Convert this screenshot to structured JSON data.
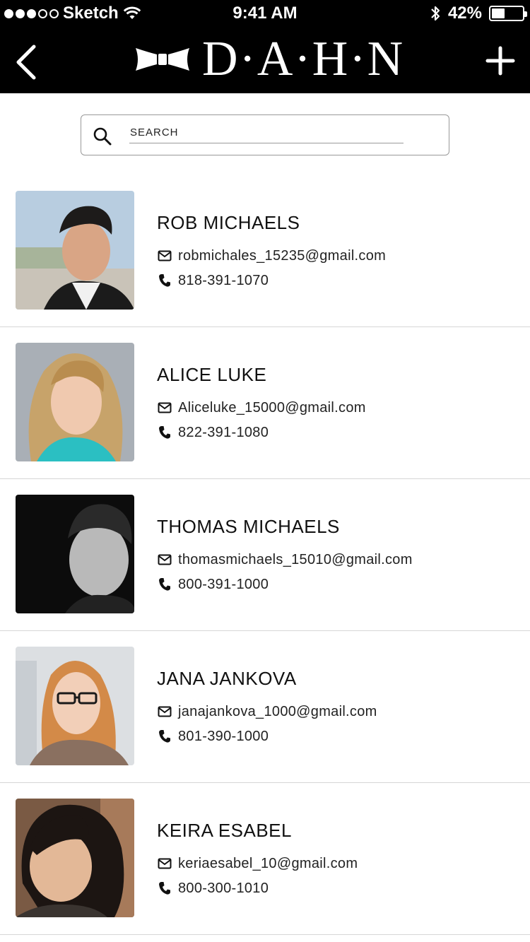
{
  "status_bar": {
    "carrier": "Sketch",
    "time": "9:41 AM",
    "battery_percent": "42%",
    "battery_level": 0.42,
    "signal_filled": 3,
    "signal_total": 5
  },
  "header": {
    "logo_text": "D·A·H·N",
    "back_icon": "chevron-left-icon",
    "add_icon": "plus-icon",
    "logo_icon": "bowtie-icon"
  },
  "search": {
    "placeholder": "SEARCH",
    "value": "",
    "icon": "search-icon"
  },
  "contacts": [
    {
      "name": "ROB MICHAELS",
      "email": "robmichales_15235@gmail.com",
      "phone": "818-391-1070"
    },
    {
      "name": "ALICE LUKE",
      "email": "Aliceluke_15000@gmail.com",
      "phone": "822-391-1080"
    },
    {
      "name": "THOMAS MICHAELS",
      "email": "thomasmichaels_15010@gmail.com",
      "phone": "800-391-1000"
    },
    {
      "name": "JANA JANKOVA",
      "email": "janajankova_1000@gmail.com",
      "phone": "801-390-1000"
    },
    {
      "name": "KEIRA ESABEL",
      "email": "keriaesabel_10@gmail.com",
      "phone": "800-300-1010"
    }
  ],
  "colors": {
    "header_bg": "#000000",
    "background": "#ffffff",
    "divider": "#d6d6d6",
    "text": "#111111"
  }
}
